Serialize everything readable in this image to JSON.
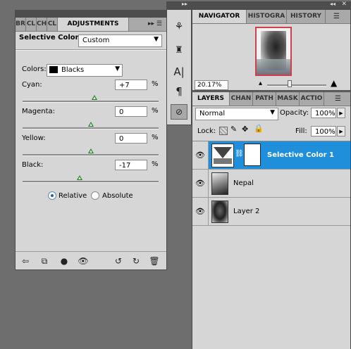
{
  "adjustments_panel": {
    "tabs": [
      "BR",
      "CL",
      "CH",
      "CL",
      "ADJUSTMENTS"
    ],
    "active_tab": "ADJUSTMENTS",
    "title": "Selective Color",
    "preset": "Custom",
    "colors_label": "Colors:",
    "colors_value": "Blacks",
    "sliders": [
      {
        "label": "Cyan:",
        "value": "+7",
        "unit": "%",
        "position": 0.53
      },
      {
        "label": "Magenta:",
        "value": "0",
        "unit": "%",
        "position": 0.5
      },
      {
        "label": "Yellow:",
        "value": "0",
        "unit": "%",
        "position": 0.5
      },
      {
        "label": "Black:",
        "value": "-17",
        "unit": "%",
        "position": 0.42
      }
    ],
    "method_relative": "Relative",
    "method_absolute": "Absolute",
    "selected_method": "Relative"
  },
  "navigator_panel": {
    "tabs": [
      "NAVIGATOR",
      "HISTOGRA",
      "HISTORY"
    ],
    "active_tab": "NAVIGATOR",
    "zoom": "20.17%",
    "zoom_slider_position": 0.38
  },
  "layers_panel": {
    "tabs": [
      "LAYERS",
      "CHAN",
      "PATH",
      "MASK",
      "ACTIO"
    ],
    "active_tab": "LAYERS",
    "blend_mode": "Normal",
    "opacity_label": "Opacity:",
    "opacity": "100%",
    "lock_label": "Lock:",
    "fill_label": "Fill:",
    "fill": "100%",
    "layers": [
      {
        "name": "Selective Color 1",
        "selected": true
      },
      {
        "name": "Nepal",
        "selected": false
      },
      {
        "name": "Layer 2",
        "selected": false
      }
    ]
  },
  "colors": {
    "accent": "#1f8fdc",
    "nav_frame": "#d0404a"
  }
}
